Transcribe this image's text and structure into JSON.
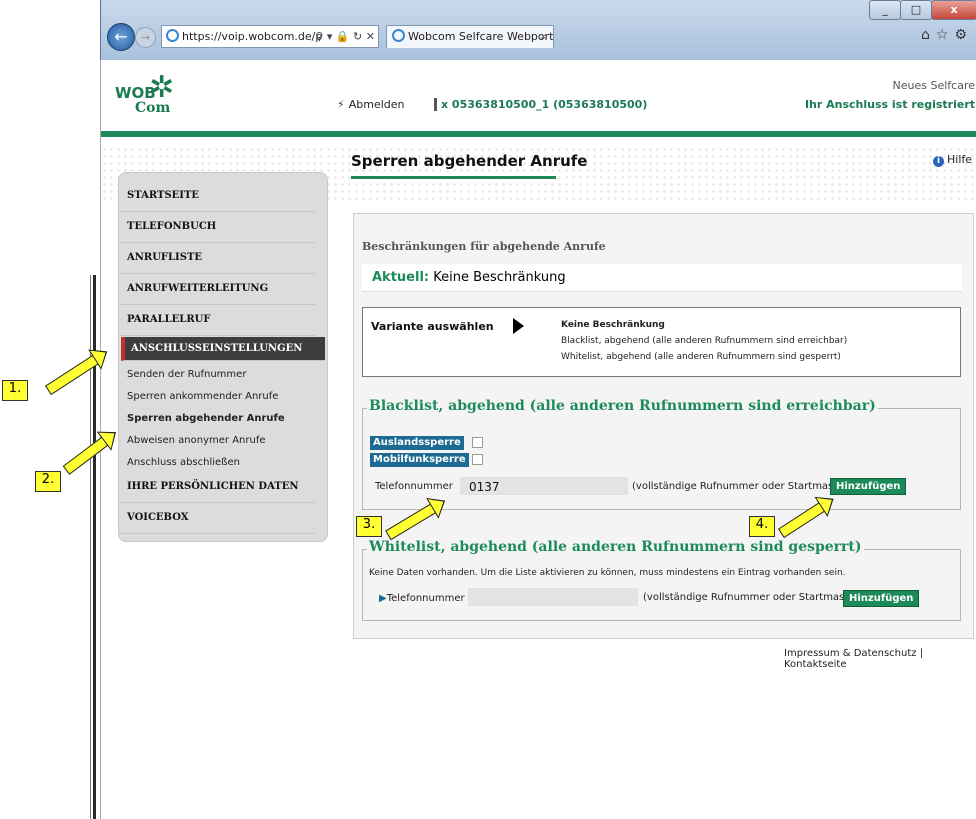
{
  "browser": {
    "url": "https://voip.wobcom.de/p",
    "tab_title": "Wobcom Selfcare Webportal",
    "minimize": "_",
    "maximize": "□",
    "close": "x"
  },
  "header": {
    "logo_top": "WOB",
    "logo_bottom": "Com",
    "logout": "Abmelden",
    "account": "x 05363810500_1 (05363810500)",
    "neues": "Neues Selfcare",
    "status": "Ihr Anschluss ist registriert"
  },
  "sidebar": {
    "items": [
      "STARTSEITE",
      "TELEFONBUCH",
      "ANRUFLISTE",
      "ANRUFWEITERLEITUNG",
      "PARALLELRUF",
      "ANSCHLUSSEINSTELLUNGEN",
      "IHRE PERSÖNLICHEN DATEN",
      "VOICEBOX"
    ],
    "sub_items": [
      "Senden der Rufnummer",
      "Sperren ankommender Anrufe",
      "Sperren abgehender Anrufe",
      "Abweisen anonymer Anrufe",
      "Anschluss abschließen"
    ]
  },
  "content": {
    "title": "Sperren abgehender Anrufe",
    "help": "Hilfe",
    "box_heading": "Beschränkungen für abgehende Anrufe",
    "current_label": "Aktuell:",
    "current_value": "Keine Beschränkung",
    "variant_label": "Variante auswählen",
    "options": [
      "Keine Beschränkung",
      "Blacklist, abgehend (alle anderen Rufnummern sind erreichbar)",
      "Whitelist, abgehend (alle anderen Rufnummern sind gesperrt)"
    ],
    "blacklist": {
      "legend": "Blacklist, abgehend (alle anderen Rufnummern sind erreichbar)",
      "tag1": "Auslandssperre",
      "tag2": "Mobilfunksperre",
      "tel_label": "Telefonnummer",
      "tel_value": "0137",
      "hint": "(vollständige Rufnummer oder Startmaske)",
      "add": "Hinzufügen"
    },
    "whitelist": {
      "legend": "Whitelist, abgehend (alle anderen Rufnummern sind gesperrt)",
      "nodata": "Keine Daten vorhanden. Um die Liste aktivieren zu können, muss mindestens ein Eintrag vorhanden sein.",
      "tel_label": "Telefonnummer",
      "tel_value": "",
      "hint": "(vollständige Rufnummer oder Startmaske)",
      "add": "Hinzufügen"
    },
    "footer": "Impressum & Datenschutz | Kontaktseite"
  },
  "annotations": [
    "1.",
    "2.",
    "3.",
    "4."
  ],
  "colors": {
    "brand_green": "#1d8a5a",
    "active_menu": "#3d3d3d",
    "callout": "#ffff33"
  }
}
